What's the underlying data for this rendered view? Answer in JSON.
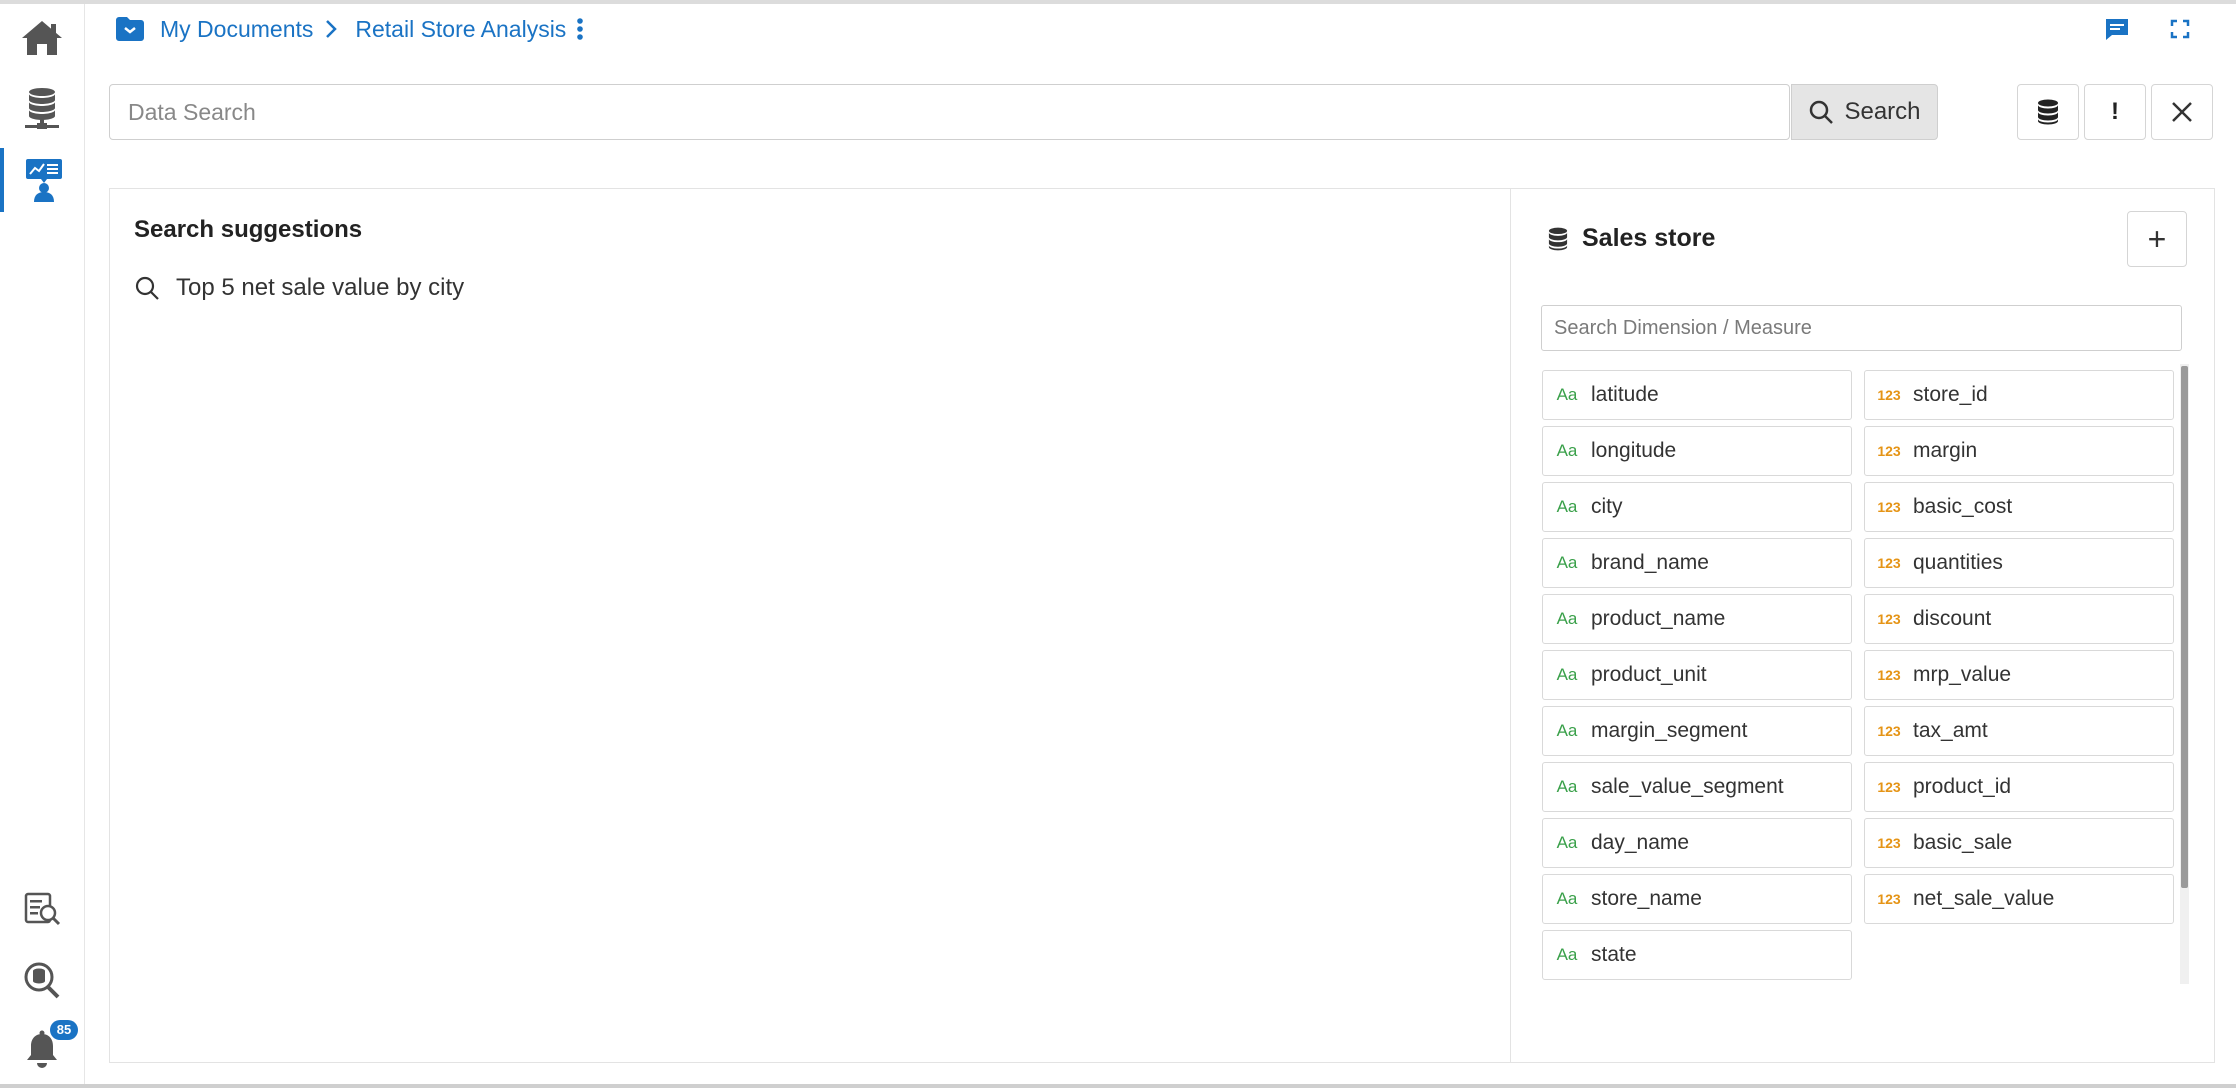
{
  "breadcrumb": {
    "root": "My Documents",
    "current": "Retail Store Analysis"
  },
  "search": {
    "placeholder": "Data Search",
    "button_label": "Search"
  },
  "toolbar": {
    "info_label": "!"
  },
  "notifications": {
    "count": "85"
  },
  "suggestions": {
    "title": "Search suggestions",
    "items": [
      "Top 5 net sale value by city"
    ]
  },
  "datastore": {
    "name": "Sales store",
    "add_label": "+",
    "search_placeholder": "Search Dimension / Measure",
    "dimension_tag": "Aa",
    "measure_tag": "123",
    "dimensions": [
      "latitude",
      "longitude",
      "city",
      "brand_name",
      "product_name",
      "product_unit",
      "margin_segment",
      "sale_value_segment",
      "day_name",
      "store_name",
      "state"
    ],
    "measures": [
      "store_id",
      "margin",
      "basic_cost",
      "quantities",
      "discount",
      "mrp_value",
      "tax_amt",
      "product_id",
      "basic_sale",
      "net_sale_value"
    ]
  },
  "colors": {
    "accent": "#1a73c4",
    "dimension": "#3aa04a",
    "measure": "#e59416"
  }
}
